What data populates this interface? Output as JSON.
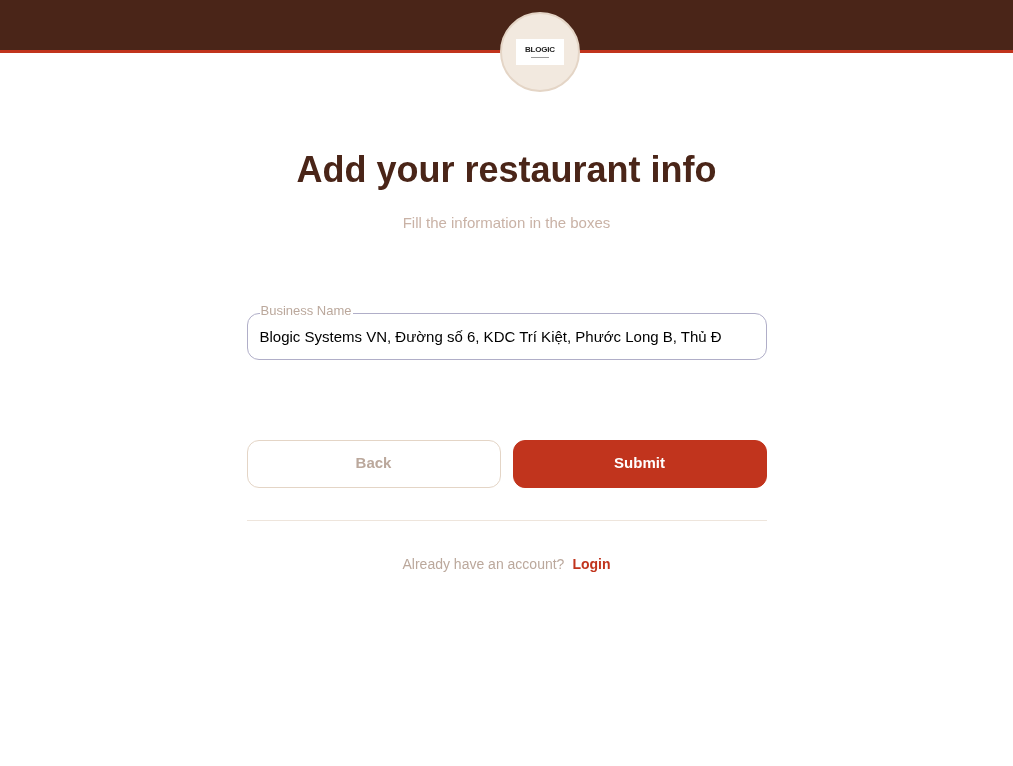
{
  "header": {
    "logo": {
      "text": "BLOGIC"
    }
  },
  "title": "Add your restaurant info",
  "subtitle": "Fill the information in the boxes",
  "fields": [
    {
      "label": "Business Name",
      "value": "Blogic Systems VN, Đường số 6, KDC Trí Kiệt, Phước Long B, Thủ Đ"
    }
  ],
  "buttons": [
    {
      "label": "Back",
      "kind": "secondary"
    },
    {
      "label": "Submit",
      "kind": "primary"
    }
  ],
  "footer": {
    "text": "Already have an account?",
    "link": "Login"
  }
}
